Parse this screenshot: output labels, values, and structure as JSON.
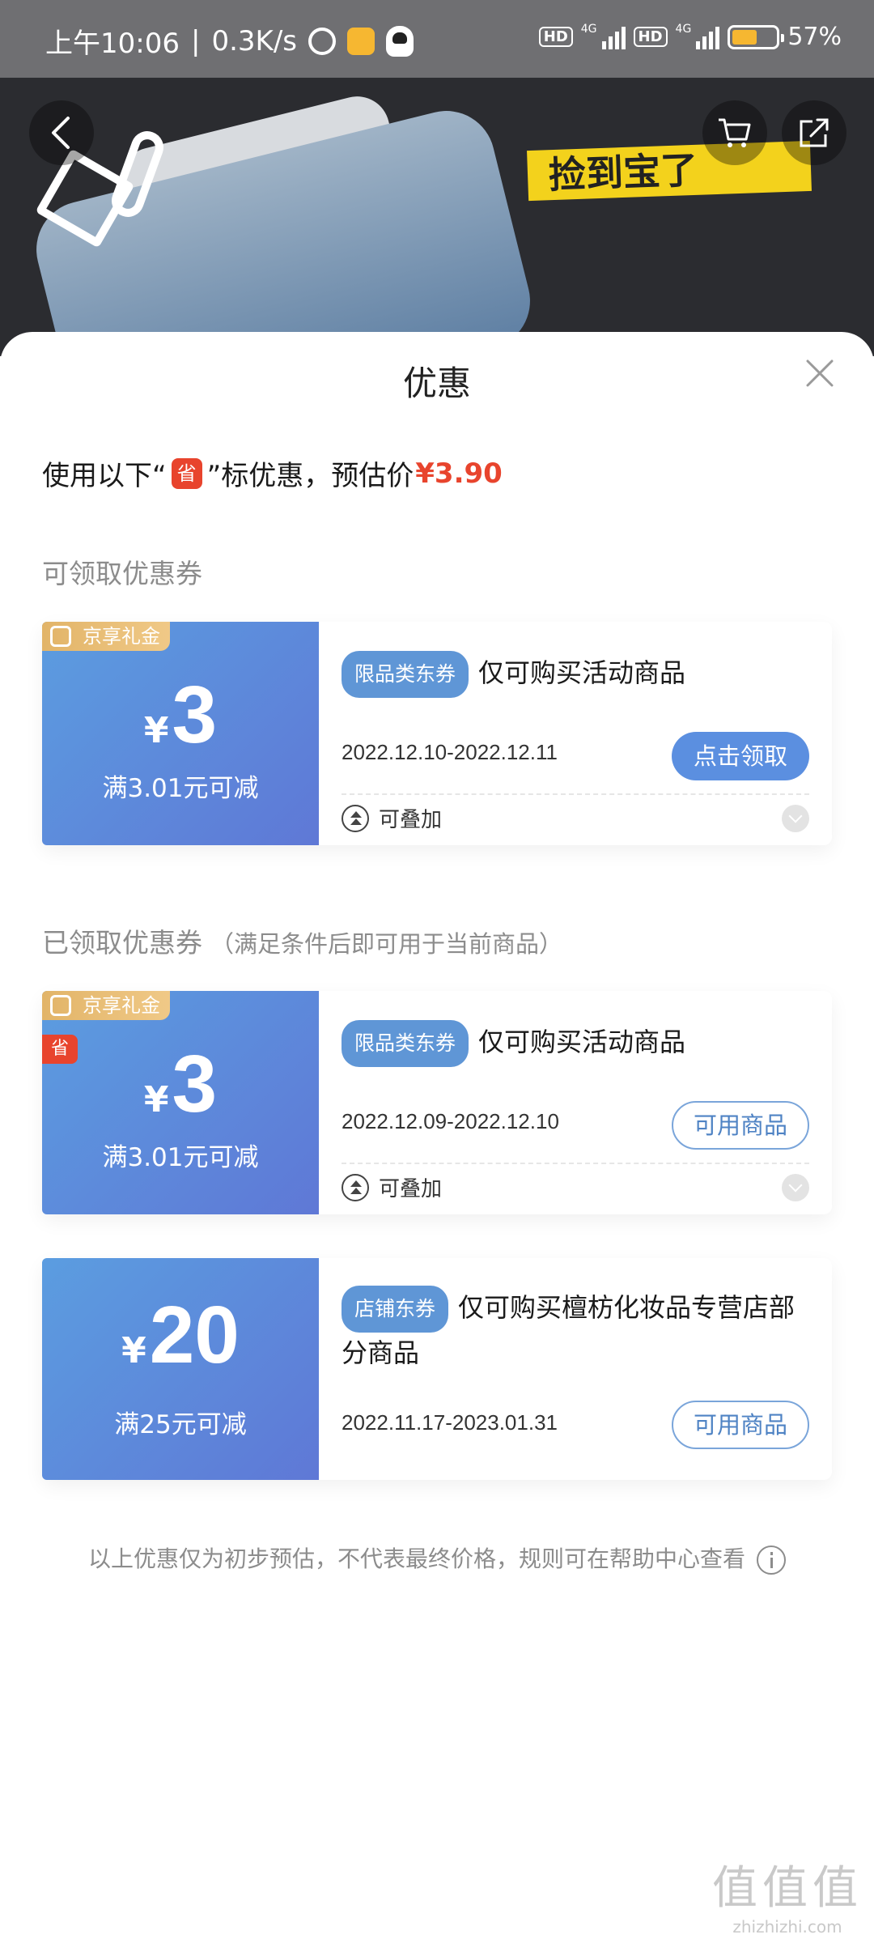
{
  "status_bar": {
    "time": "上午10:06",
    "speed": "0.3K/s",
    "hd": "HD",
    "net": "4G",
    "battery_pct": "57%",
    "battery_level": 0.57
  },
  "product_header": {
    "banner_text": "捡到宝了"
  },
  "sheet": {
    "title": "优惠",
    "summary_prefix": "使用以下“",
    "sheng_icon": "省",
    "summary_suffix": "”标优惠，预估价",
    "estimated_price": "¥3.90"
  },
  "sections": {
    "claimable_label": "可领取优惠券",
    "claimed_label": "已领取优惠券",
    "claimed_sub": "（满足条件后即可用于当前商品）"
  },
  "coupons": [
    {
      "gift_tag": "京享礼金",
      "currency": "¥",
      "amount": "3",
      "threshold": "满3.01元可减",
      "type_tag": "限品类东券",
      "title": "仅可购买活动商品",
      "date": "2022.12.10-2022.12.11",
      "action": "点击领取",
      "stack_label": "可叠加"
    },
    {
      "gift_tag": "京享礼金",
      "sheng_tag": "省",
      "currency": "¥",
      "amount": "3",
      "threshold": "满3.01元可减",
      "type_tag": "限品类东券",
      "title": "仅可购买活动商品",
      "date": "2022.12.09-2022.12.10",
      "action": "可用商品",
      "stack_label": "可叠加"
    },
    {
      "currency": "¥",
      "amount": "20",
      "threshold": "满25元可减",
      "type_tag": "店铺东券",
      "title": "仅可购买檀枋化妆品专营店部分商品",
      "date": "2022.11.17-2023.01.31",
      "action": "可用商品"
    }
  ],
  "footnote": "以上优惠仅为初步预估，不代表最终价格，规则可在帮助中心查看",
  "watermark": {
    "glyphs": "值值值",
    "url": "zhizhizhi.com"
  },
  "colors": {
    "accent_blue": "#5b8fe0",
    "price_red": "#e8442d",
    "gift_gold": "#e2b468"
  }
}
